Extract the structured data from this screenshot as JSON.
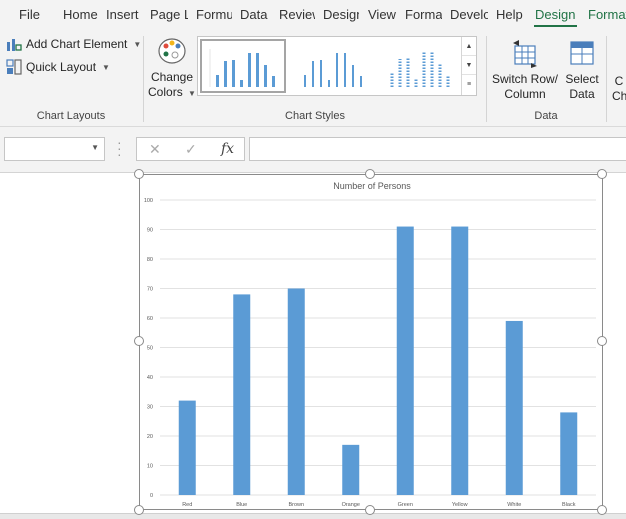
{
  "tabs": [
    "File",
    "Home",
    "Insert",
    "Page Layout",
    "Formulas",
    "Data",
    "Review",
    "Design",
    "View",
    "Format",
    "Developer",
    "Help",
    "Design",
    "Format"
  ],
  "active_tab": "Design",
  "ribbon": {
    "add_chart_element": "Add Chart Element",
    "quick_layout": "Quick Layout",
    "change_colors_line1": "Change",
    "change_colors_line2": "Colors",
    "switch_line1": "Switch Row/",
    "switch_line2": "Column",
    "select_line1": "Select",
    "select_line2": "Data",
    "groups": {
      "chart_layouts": "Chart Layouts",
      "chart_styles": "Chart Styles",
      "data": "Data"
    }
  },
  "formula_bar": {
    "name_box_value": "",
    "formula_value": "",
    "fx_label": "fx"
  },
  "colors": {
    "bar": "#5b9bd5",
    "accent": "#217346",
    "grid": "#d9d9d9",
    "text": "#595959"
  },
  "chart_data": {
    "type": "bar",
    "title": "Number of Persons",
    "categories": [
      "Red",
      "Blue",
      "Brown",
      "Orange",
      "Green",
      "Yellow",
      "White",
      "Black"
    ],
    "values": [
      32,
      68,
      70,
      17,
      91,
      91,
      59,
      28
    ],
    "ylim": [
      0,
      100
    ],
    "yticks": [
      0,
      10,
      20,
      30,
      40,
      50,
      60,
      70,
      80,
      90,
      100
    ],
    "grid": true,
    "legend": "none",
    "xlabel": "",
    "ylabel": ""
  }
}
